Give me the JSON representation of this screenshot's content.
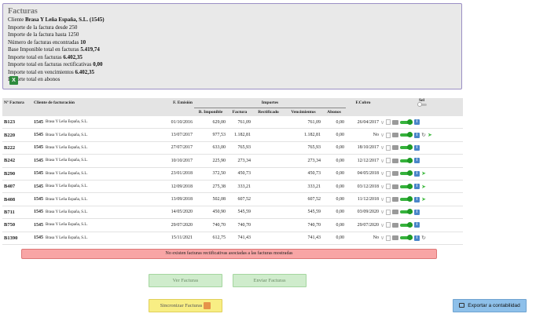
{
  "summary": {
    "title": "Facturas",
    "cliente_label": "Cliente",
    "cliente_value": "Brasa Y Leña España, S.L. (1545)",
    "importe_desde": "Importe de la factura desde 250",
    "importe_hasta": "Importe de la factura hasta 1250",
    "num_label": "Número de facturas encontradas",
    "num_value": "10",
    "base_label": "Base Imponible total en facturas",
    "base_value": "5.419,74",
    "total_label": "Importe total en facturas",
    "total_value": "6.402,35",
    "rect_label": "Importe total en facturas rectificativas",
    "rect_value": "0,00",
    "venc_label": "Importe total en vencimientos",
    "venc_value": "6.402,35",
    "abonos_label": "Importe total en abonos",
    "excel_icon": "excel-icon"
  },
  "table": {
    "headers": {
      "nfactura": "Nº Factura",
      "cliente": "Cliente de facturación",
      "emision": "F. Emisión",
      "importes": "Importes",
      "fcobro": "F.Cobro",
      "sel": "Sel",
      "base": "B. Imponible",
      "factura": "Factura",
      "rectificado": "Rectificado",
      "vencimientos": "Vencimientos",
      "abonos": "Abonos"
    },
    "rows": [
      {
        "num": "B123",
        "cid": "1545",
        "cname": "Brasa Y Leña España, S.L.",
        "emision": "01/10/2016",
        "base": "629,00",
        "factura": "761,09",
        "rect": "",
        "venc": "761,09",
        "abonos": "0,00",
        "cobro": "26/04/2017",
        "toggle": "on",
        "extra": []
      },
      {
        "num": "B220",
        "cid": "1545",
        "cname": "Brasa Y Leña España, S.L.",
        "emision": "13/07/2017",
        "base": "977,53",
        "factura": "1.182,81",
        "rect": "",
        "venc": "1.182,81",
        "abonos": "0,00",
        "cobro": "No",
        "toggle": "on",
        "extra": [
          "refresh",
          "send"
        ]
      },
      {
        "num": "B222",
        "cid": "1545",
        "cname": "Brasa Y Leña España, S.L.",
        "emision": "27/07/2017",
        "base": "633,00",
        "factura": "765,93",
        "rect": "",
        "venc": "765,93",
        "abonos": "0,00",
        "cobro": "18/10/2017",
        "toggle": "on",
        "extra": []
      },
      {
        "num": "B242",
        "cid": "1545",
        "cname": "Brasa Y Leña España, S.L.",
        "emision": "10/10/2017",
        "base": "225,90",
        "factura": "273,34",
        "rect": "",
        "venc": "273,34",
        "abonos": "0,00",
        "cobro": "12/12/2017",
        "toggle": "on",
        "extra": []
      },
      {
        "num": "B290",
        "cid": "1545",
        "cname": "Brasa Y Leña España, S.L.",
        "emision": "23/01/2018",
        "base": "372,50",
        "factura": "450,73",
        "rect": "",
        "venc": "450,73",
        "abonos": "0,00",
        "cobro": "04/05/2018",
        "toggle": "on",
        "extra": [
          "send"
        ]
      },
      {
        "num": "B407",
        "cid": "1545",
        "cname": "Brasa Y Leña España, S.L.",
        "emision": "12/09/2018",
        "base": "275,38",
        "factura": "333,21",
        "rect": "",
        "venc": "333,21",
        "abonos": "0,00",
        "cobro": "03/12/2018",
        "toggle": "on",
        "extra": [
          "send"
        ]
      },
      {
        "num": "B408",
        "cid": "1545",
        "cname": "Brasa Y Leña España, S.L.",
        "emision": "13/09/2018",
        "base": "502,08",
        "factura": "607,52",
        "rect": "",
        "venc": "607,52",
        "abonos": "0,00",
        "cobro": "11/12/2018",
        "toggle": "on",
        "extra": [
          "send"
        ]
      },
      {
        "num": "B711",
        "cid": "1545",
        "cname": "Brasa Y Leña España, S.L.",
        "emision": "14/05/2020",
        "base": "450,90",
        "factura": "545,59",
        "rect": "",
        "venc": "545,59",
        "abonos": "0,00",
        "cobro": "03/09/2020",
        "toggle": "on",
        "extra": []
      },
      {
        "num": "B750",
        "cid": "1545",
        "cname": "Brasa Y Leña España, S.L.",
        "emision": "29/07/2020",
        "base": "740,70",
        "factura": "740,70",
        "rect": "",
        "venc": "740,70",
        "abonos": "0,00",
        "cobro": "29/07/2020",
        "toggle": "on",
        "extra": []
      },
      {
        "num": "B1390",
        "cid": "1545",
        "cname": "Brasa Y Leña España, S.L.",
        "emision": "15/11/2021",
        "base": "612,75",
        "factura": "741,43",
        "rect": "",
        "venc": "741,43",
        "abonos": "0,00",
        "cobro": "No",
        "toggle": "on",
        "extra": [
          "refresh"
        ]
      }
    ]
  },
  "alert": {
    "text": "No existen facturas rectificativas asociadas a las facturas mostradas"
  },
  "buttons": {
    "ver": "Ver Facturas",
    "enviar": "Enviar Facturas",
    "sincronizar": "Sincronizar Facturas",
    "exportar": "Exportar a contabilidad"
  }
}
